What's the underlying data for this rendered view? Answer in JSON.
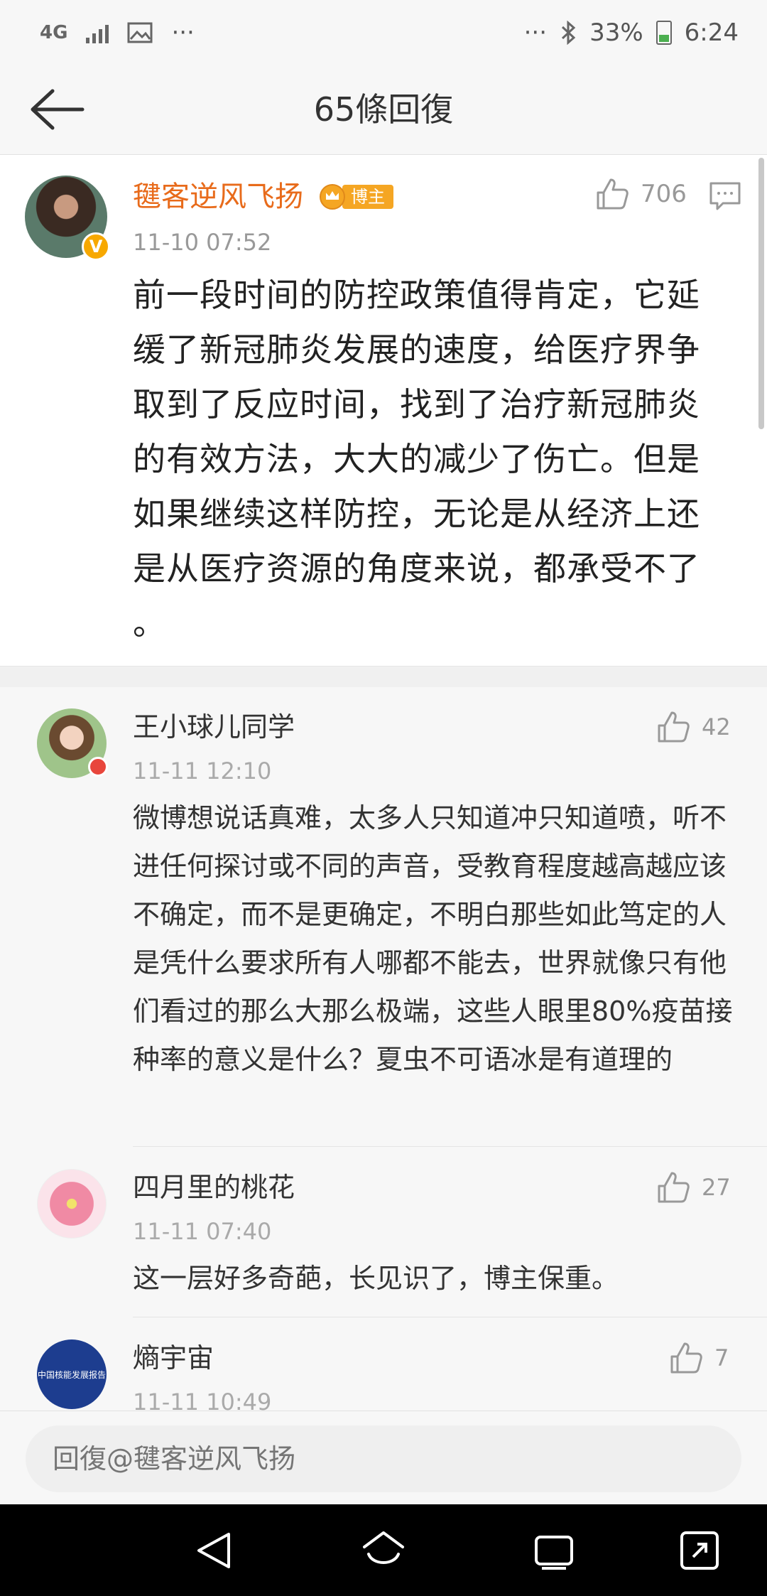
{
  "status_bar": {
    "network": "4G",
    "more": "···",
    "more_right": "···",
    "battery": "33%",
    "time": "6:24"
  },
  "header": {
    "title": "65條回復"
  },
  "main_post": {
    "username": "毽客逆风飞扬",
    "badge": "博主",
    "verified": "V",
    "time": "11-10 07:52",
    "likes": "706",
    "text": "  前一段时间的防控政策值得肯定，它延缓了新冠肺炎发展的速度，给医疗界争取到了反应时间，找到了治疗新冠肺炎的有效方法，大大的减少了伤亡。但是如果继续这样防控，无论是从经济上还是从医疗资源的角度来说，都承受不了 。"
  },
  "replies": [
    {
      "name": "王小球儿同学",
      "time": "11-11 12:10",
      "likes": "42",
      "text": "微博想说话真难，太多人只知道冲只知道喷，听不进任何探讨或不同的声音，受教育程度越高越应该不确定，而不是更确定，不明白那些如此笃定的人是凭什么要求所有人哪都不能去，世界就像只有他们看过的那么大那么极端，这些人眼里80%疫苗接种率的意义是什么？夏虫不可语冰是有道理的"
    },
    {
      "name": "四月里的桃花",
      "time": "11-11 07:40",
      "likes": "27",
      "text": "这一层好多奇葩，长见识了，博主保重。"
    },
    {
      "name": "熵宇宙",
      "time": "11-11 10:49",
      "likes": "7",
      "avatar_text": "中国核能发展报告"
    }
  ],
  "reply_bar": {
    "placeholder": "回復@毽客逆风飞扬"
  }
}
